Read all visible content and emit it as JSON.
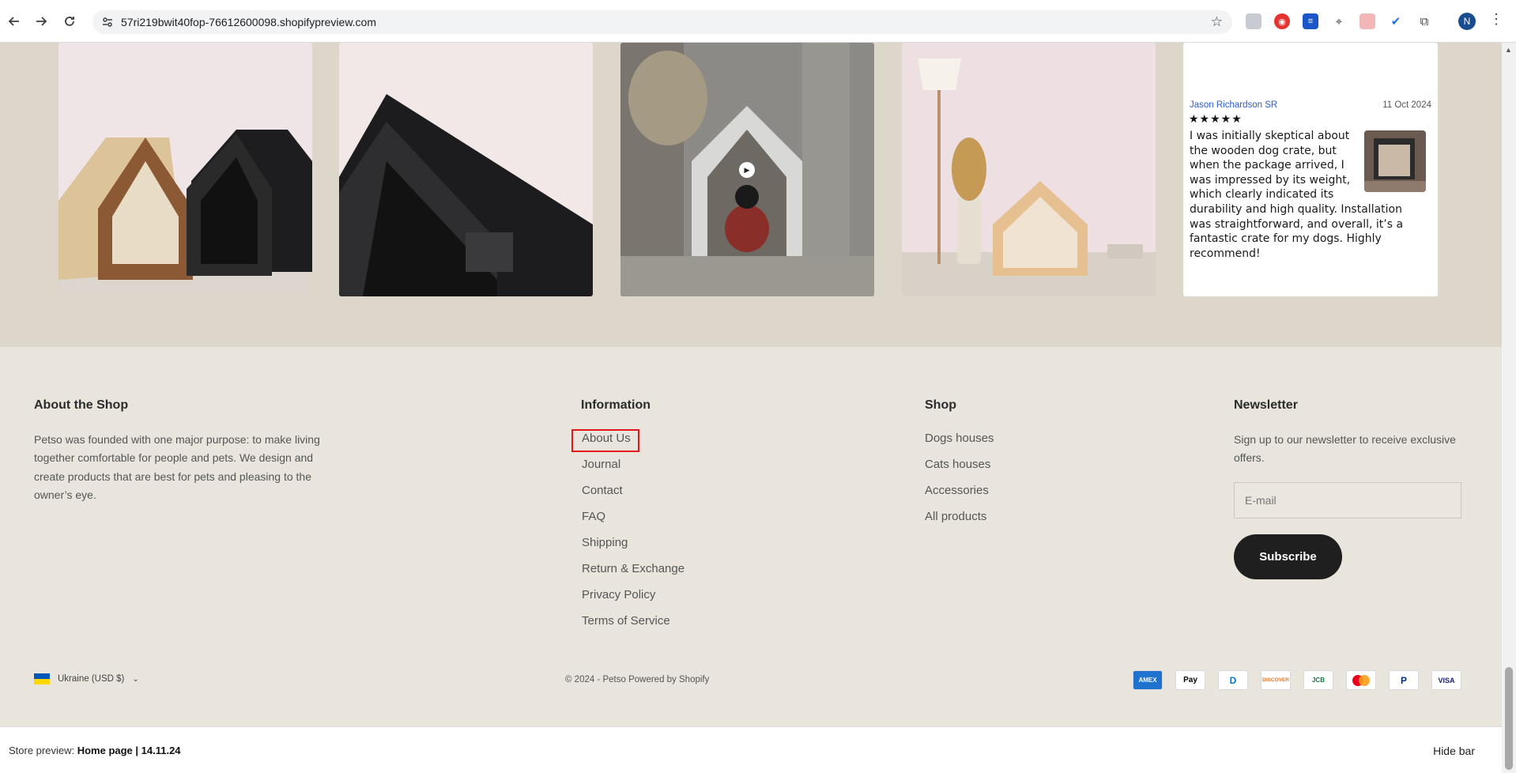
{
  "browser": {
    "url": "57ri219bwit40fop-76612600098.shopifypreview.com",
    "back_icon": "arrow-left-icon",
    "forward_icon": "arrow-right-icon",
    "reload_icon": "reload-icon",
    "profile_initial": "N"
  },
  "review": {
    "author": "Jason Richardson SR",
    "date": "11 Oct 2024",
    "stars": "★★★★★",
    "text": "I was initially skeptical about the wooden dog crate, but when the package arrived, I was impressed by its weight, which clearly indicated its durability and high quality. Installation was straightforward, and overall, it’s a fantastic crate for my dogs. Highly recommend!"
  },
  "footer": {
    "about": {
      "title": "About the Shop",
      "text": "Petso was founded with one major purpose: to make living together comfortable for people and pets. We design and create products that are best for pets and pleasing to the owner’s eye."
    },
    "information": {
      "title": "Information",
      "links": [
        "About Us",
        "Journal",
        "Contact",
        "FAQ",
        "Shipping",
        "Return & Exchange",
        "Privacy Policy",
        "Terms of Service"
      ]
    },
    "shop": {
      "title": "Shop",
      "links": [
        "Dogs houses",
        "Cats houses",
        "Accessories",
        "All products"
      ]
    },
    "newsletter": {
      "title": "Newsletter",
      "text": "Sign up to our newsletter to receive exclusive offers.",
      "email_placeholder": "E-mail",
      "subscribe_label": "Subscribe"
    },
    "country": "Ukraine (USD $)",
    "copyright": "© 2024 - Petso Powered by Shopify",
    "payment_methods": [
      "AMEX",
      "Pay",
      "D",
      "DISCOVER",
      "JCB",
      "MC",
      "P",
      "VISA"
    ]
  },
  "preview_bar": {
    "prefix": "Store preview:",
    "name": "Home page | 14.11.24",
    "hide_label": "Hide bar"
  },
  "colors": {
    "accent_highlight": "#e3161b",
    "gallery_bg": "#dcd6cb",
    "footer_bg": "#e9e5dd"
  }
}
